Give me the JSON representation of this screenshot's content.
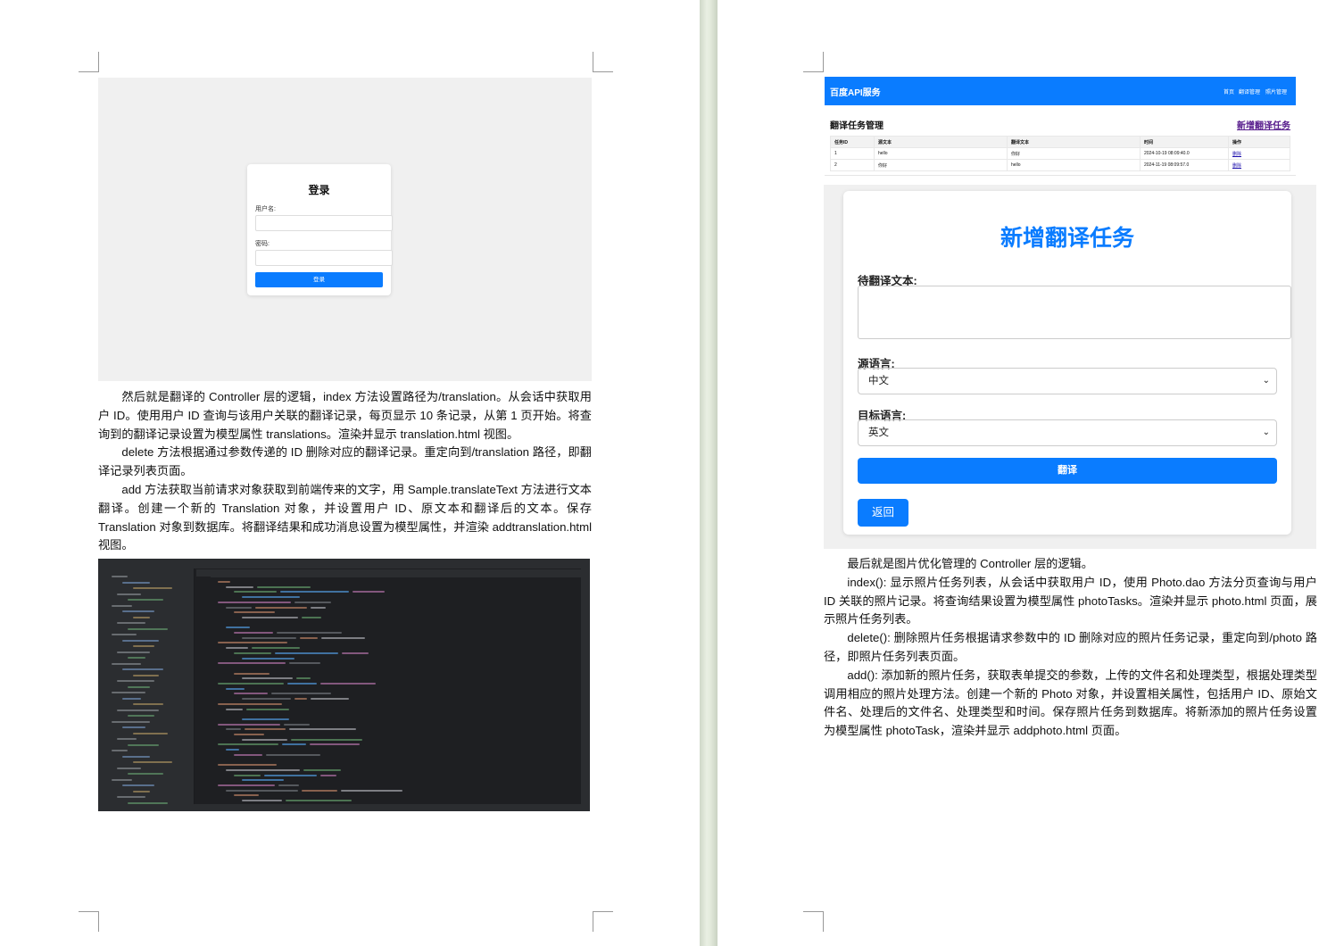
{
  "left_page": {
    "login_screenshot": {
      "title": "登录",
      "username_label": "用户名:",
      "password_label": "密码:",
      "button": "登录"
    },
    "paragraphs": [
      "然后就是翻译的 Controller 层的逻辑，index 方法设置路径为/translation。从会话中获取用户 ID。使用用户 ID 查询与该用户关联的翻译记录，每页显示 10 条记录，从第 1 页开始。将查询到的翻译记录设置为模型属性 translations。渲染并显示 translation.html 视图。",
      "delete 方法根据通过参数传递的 ID 删除对应的翻译记录。重定向到/translation 路径，即翻译记录列表页面。",
      "add 方法获取当前请求对象获取到前端传来的文字，用 Sample.translateText 方法进行文本翻译。创建一个新的 Translation 对象，并设置用户 ID、原文本和翻译后的文本。保存 Translation 对象到数据库。将翻译结果和成功消息设置为模型属性，并渲染 addtranslation.html 视图。"
    ]
  },
  "right_page": {
    "list_screenshot": {
      "brand": "百度API服务",
      "nav": [
        "首页",
        "翻译管理",
        "照片管理"
      ],
      "heading": "翻译任务管理",
      "new_link": "新增翻译任务",
      "columns": [
        "任务ID",
        "源文本",
        "翻译文本",
        "时间",
        "操作"
      ],
      "rows": [
        [
          "1",
          "hello",
          "你好",
          "2024-10-19 08:09:40.0",
          "删除"
        ],
        [
          "2",
          "你好",
          "hello",
          "2024-11-19 08:09:57.0",
          "删除"
        ]
      ]
    },
    "form_screenshot": {
      "title": "新增翻译任务",
      "text_label": "待翻译文本:",
      "source_label": "源语言:",
      "source_value": "中文",
      "target_label": "目标语言:",
      "target_value": "英文",
      "submit": "翻译",
      "back": "返回"
    },
    "paragraphs": [
      "最后就是图片优化管理的 Controller 层的逻辑。",
      "index(): 显示照片任务列表，从会话中获取用户 ID，使用 Photo.dao 方法分页查询与用户 ID 关联的照片记录。将查询结果设置为模型属性 photoTasks。渲染并显示 photo.html 页面，展示照片任务列表。",
      "delete(): 删除照片任务根据请求参数中的 ID 删除对应的照片任务记录，重定向到/photo 路径，即照片任务列表页面。",
      "add(): 添加新的照片任务，获取表单提交的参数，上传的文件名和处理类型，根据处理类型调用相应的照片处理方法。创建一个新的 Photo 对象，并设置相关属性，包括用户 ID、原始文件名、处理后的文件名、处理类型和时间。保存照片任务到数据库。将新添加的照片任务设置为模型属性 photoTask，渲染并显示 addphoto.html 页面。"
    ]
  },
  "colors": {
    "accent": "#0a7cff",
    "ide_background": "#1e1f22",
    "gutter": "#e3eadc"
  }
}
